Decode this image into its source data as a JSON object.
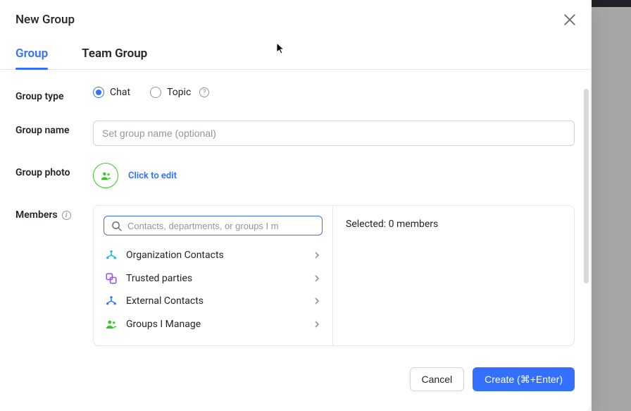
{
  "modal": {
    "title": "New Group",
    "tabs": [
      {
        "label": "Group",
        "active": true
      },
      {
        "label": "Team Group",
        "active": false
      }
    ]
  },
  "group_type": {
    "label": "Group type",
    "options": [
      {
        "label": "Chat",
        "selected": true
      },
      {
        "label": "Topic",
        "selected": false
      }
    ]
  },
  "group_name": {
    "label": "Group name",
    "placeholder": "Set group name (optional)",
    "value": ""
  },
  "group_photo": {
    "label": "Group photo",
    "edit_link": "Click to edit"
  },
  "members": {
    "label": "Members",
    "search_placeholder": "Contacts, departments, or groups I m",
    "sources": [
      {
        "label": "Organization Contacts",
        "icon": "org"
      },
      {
        "label": "Trusted parties",
        "icon": "trusted"
      },
      {
        "label": "External Contacts",
        "icon": "external"
      },
      {
        "label": "Groups I Manage",
        "icon": "groups"
      }
    ],
    "selected_text": "Selected: 0 members"
  },
  "footer": {
    "cancel": "Cancel",
    "create": "Create (⌘+Enter)"
  }
}
